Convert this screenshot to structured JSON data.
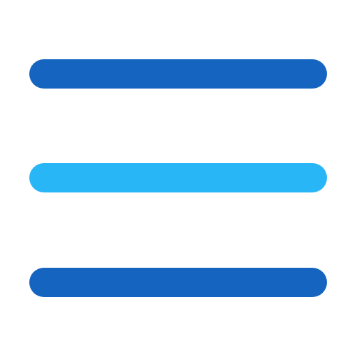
{
  "icon": {
    "name": "hamburger-menu-icon",
    "colors": {
      "primary": "#1565C0",
      "accent": "#29B6F6",
      "background": "#FFFFFF"
    },
    "bars": [
      {
        "name": "top",
        "color": "#1565C0"
      },
      {
        "name": "middle",
        "color": "#29B6F6"
      },
      {
        "name": "bottom",
        "color": "#1565C0"
      }
    ]
  }
}
